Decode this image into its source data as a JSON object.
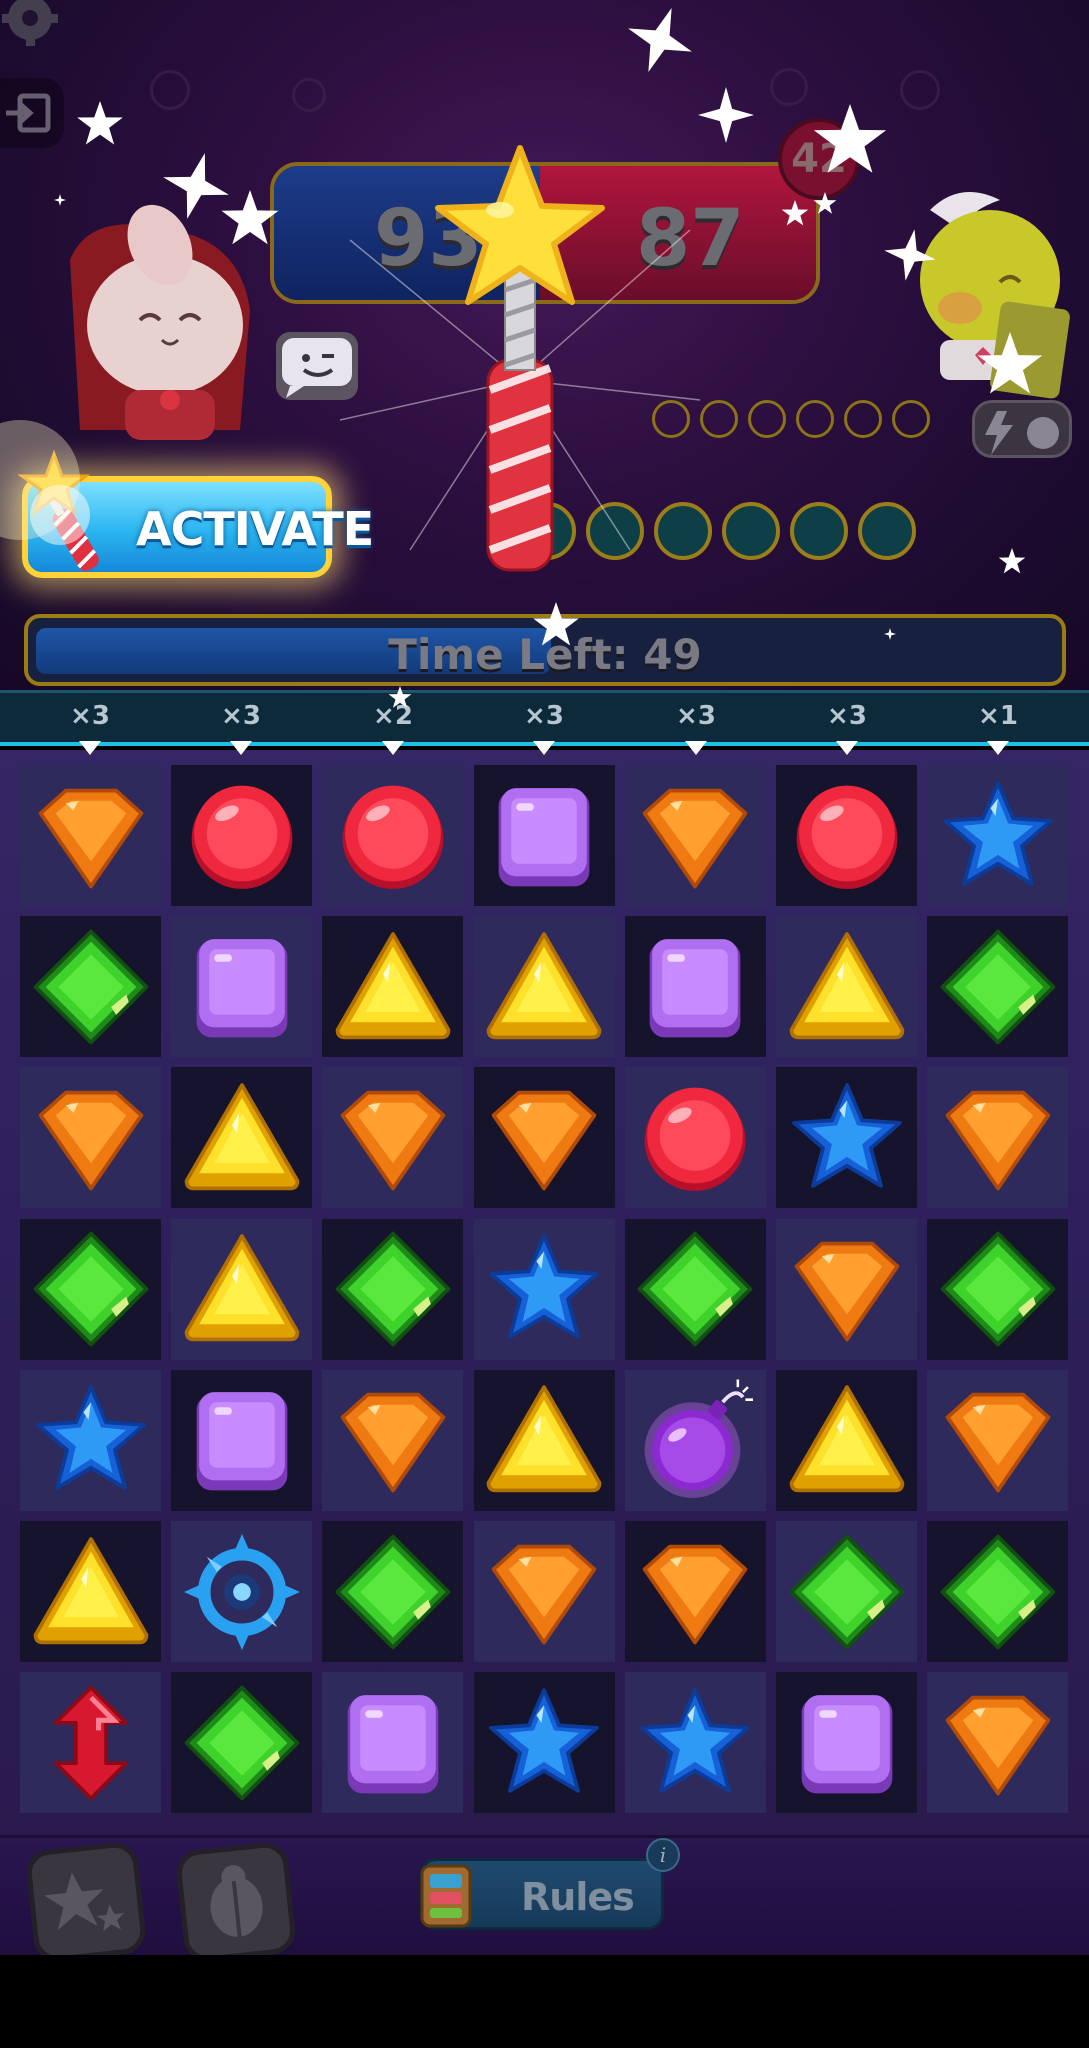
{
  "scores": {
    "left": "93",
    "right": "87"
  },
  "round": "42",
  "activate": {
    "label": "ACTIVATE"
  },
  "timer": {
    "text": "Time Left: 49",
    "progress": 0.49
  },
  "multipliers": [
    "×3",
    "×3",
    "×2",
    "×3",
    "×3",
    "×3",
    "×1"
  ],
  "board": {
    "rows": [
      [
        "orange-gem",
        "red-gem",
        "red-gem",
        "purple-gem",
        "orange-gem",
        "red-gem",
        "blue-star-gem"
      ],
      [
        "green-gem",
        "purple-gem",
        "yellow-gem",
        "yellow-gem",
        "purple-gem",
        "yellow-gem",
        "green-gem"
      ],
      [
        "orange-gem",
        "yellow-gem",
        "orange-gem",
        "orange-gem",
        "red-gem",
        "blue-star-gem",
        "orange-gem"
      ],
      [
        "green-gem",
        "yellow-gem",
        "green-gem",
        "blue-star-gem",
        "green-gem",
        "orange-gem",
        "green-gem"
      ],
      [
        "blue-star-gem",
        "purple-gem",
        "orange-gem",
        "yellow-gem",
        "bomb",
        "yellow-gem",
        "orange-gem"
      ],
      [
        "yellow-gem",
        "target-gem",
        "green-gem",
        "orange-gem",
        "orange-gem",
        "green-gem",
        "green-gem"
      ],
      [
        "vertical-arrow-gem",
        "green-gem",
        "purple-gem",
        "blue-star-gem",
        "blue-star-gem",
        "purple-gem",
        "orange-gem"
      ]
    ]
  },
  "bottom": {
    "rules_label": "Rules",
    "info_label": "i"
  },
  "icons": {
    "settings": "gear-icon",
    "exit": "exit-door-icon",
    "chat": "chat-emoji-icon",
    "power": "lightning-icon",
    "booster1": "stars-booster-icon",
    "booster2": "scarab-booster-icon"
  },
  "colors": {
    "activate": "#2bb5f0",
    "team_left": "#1d3d8a",
    "team_right": "#b0163d",
    "gold_border": "#9a7c14"
  }
}
